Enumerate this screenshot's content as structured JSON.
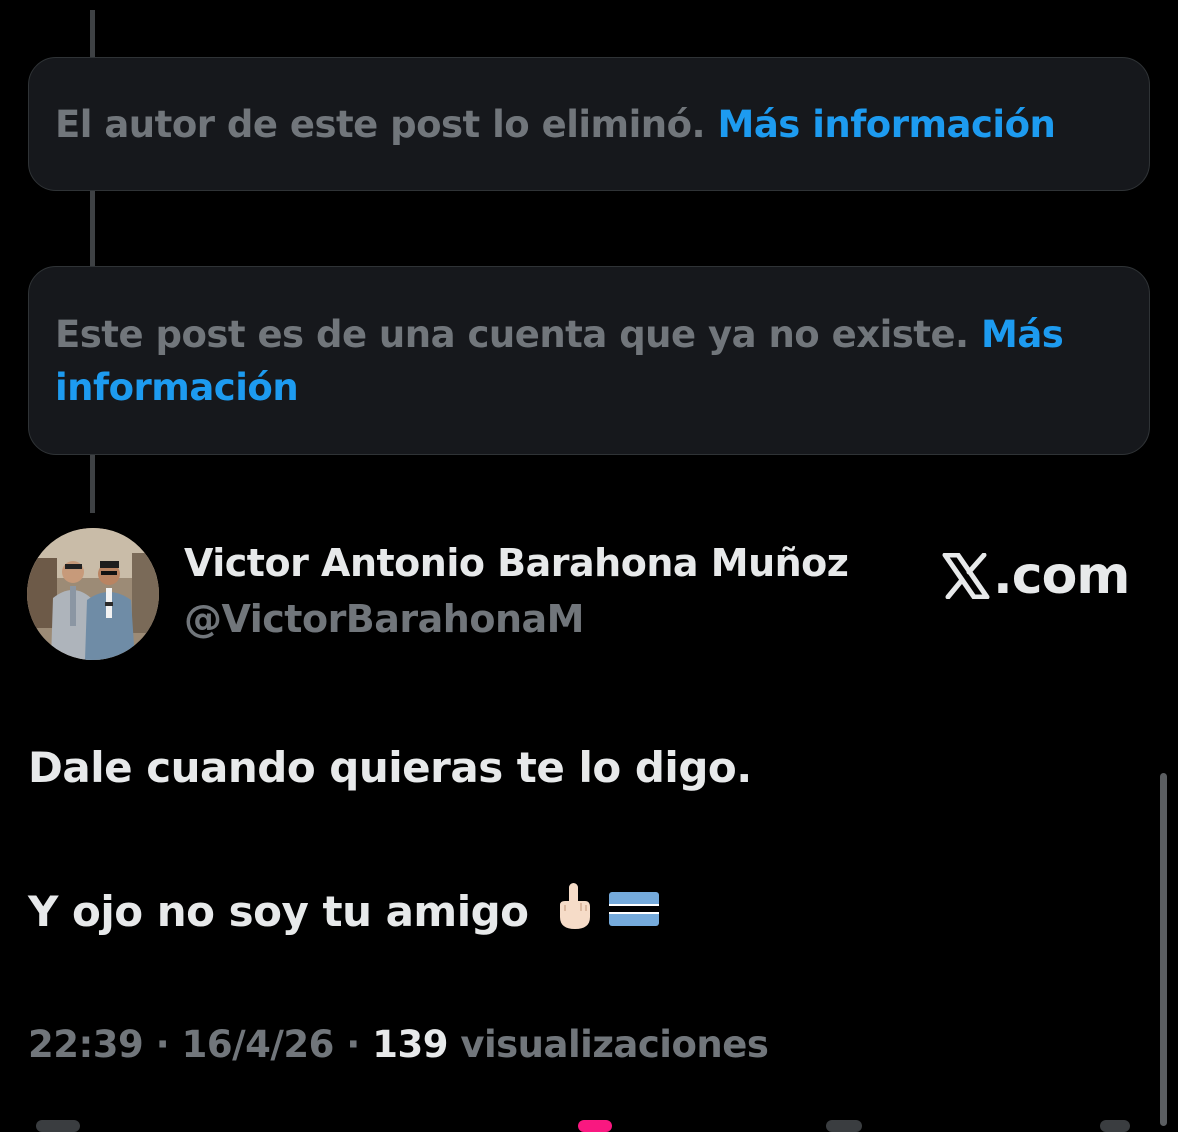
{
  "thread": {
    "deleted_notice": {
      "text": "El autor de este post lo eliminó. ",
      "link": "Más información"
    },
    "missing_account_notice": {
      "text": "Este post es de una cuenta que ya no existe. ",
      "link": "Más información"
    }
  },
  "post": {
    "author_name": "Victor Antonio Barahona Muñoz",
    "author_handle": "@VictorBarahonaM",
    "source_label": ".com",
    "lines": [
      "Dale cuando quieras te lo digo.",
      "Y ojo no soy tu amigo"
    ],
    "emojis": [
      "middle-finger-emoji",
      "botswana-flag-emoji"
    ],
    "meta": {
      "time": "22:39",
      "separator": "·",
      "date": "16/4/26",
      "views_count": "139",
      "views_label": "visualizaciones"
    }
  },
  "colors": {
    "background": "#000000",
    "card": "#16181c",
    "secondary_text": "#71767b",
    "primary_text": "#e7e9ea",
    "link": "#1d9bf0"
  }
}
